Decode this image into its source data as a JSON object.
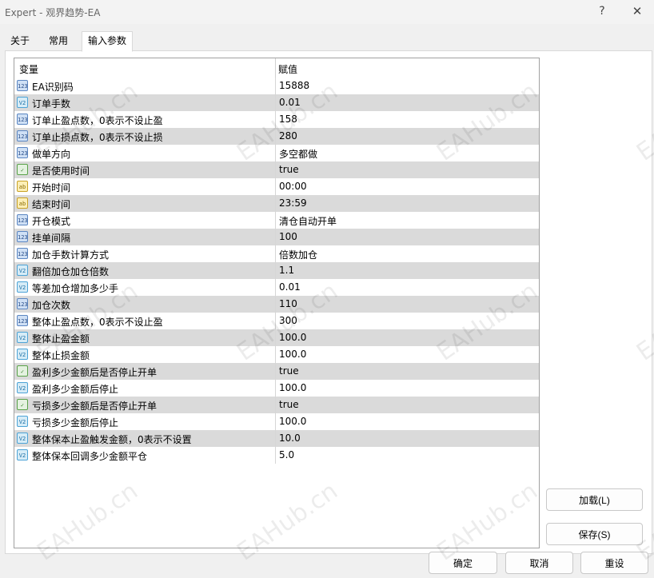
{
  "window": {
    "title": "Expert - 观界趋势-EA",
    "help_glyph": "?",
    "close_glyph": "✕"
  },
  "tabs": [
    {
      "label": "关于",
      "active": false
    },
    {
      "label": "常用",
      "active": false
    },
    {
      "label": "输入参数",
      "active": true
    }
  ],
  "grid": {
    "col_variable": "变量",
    "col_value": "赋值",
    "rows": [
      {
        "icon": "123",
        "name": "EA识别码",
        "value": "15888"
      },
      {
        "icon": "v2",
        "name": "订单手数",
        "value": "0.01"
      },
      {
        "icon": "123",
        "name": "订单止盈点数，0表示不设止盈",
        "value": "158"
      },
      {
        "icon": "123",
        "name": "订单止损点数，0表示不设止损",
        "value": "280"
      },
      {
        "icon": "123",
        "name": "做单方向",
        "value": "多空都做"
      },
      {
        "icon": "bool",
        "name": "是否使用时间",
        "value": "true"
      },
      {
        "icon": "ab",
        "name": "开始时间",
        "value": "00:00"
      },
      {
        "icon": "ab",
        "name": "结束时间",
        "value": "23:59"
      },
      {
        "icon": "123",
        "name": "开仓模式",
        "value": "清仓自动开单"
      },
      {
        "icon": "123",
        "name": "挂单间隔",
        "value": "100"
      },
      {
        "icon": "123",
        "name": "加仓手数计算方式",
        "value": "倍数加仓"
      },
      {
        "icon": "v2",
        "name": "翻倍加仓加仓倍数",
        "value": "1.1"
      },
      {
        "icon": "v2",
        "name": "等差加仓增加多少手",
        "value": "0.01"
      },
      {
        "icon": "123",
        "name": "加仓次数",
        "value": "110"
      },
      {
        "icon": "123",
        "name": "整体止盈点数，0表示不设止盈",
        "value": "300"
      },
      {
        "icon": "v2",
        "name": "整体止盈金额",
        "value": "100.0"
      },
      {
        "icon": "v2",
        "name": "整体止损金额",
        "value": "100.0"
      },
      {
        "icon": "bool",
        "name": "盈利多少金额后是否停止开单",
        "value": "true"
      },
      {
        "icon": "v2",
        "name": "盈利多少金额后停止",
        "value": "100.0"
      },
      {
        "icon": "bool",
        "name": "亏损多少金额后是否停止开单",
        "value": "true"
      },
      {
        "icon": "v2",
        "name": "亏损多少金额后停止",
        "value": "100.0"
      },
      {
        "icon": "v2",
        "name": "整体保本止盈触发金额，0表示不设置",
        "value": "10.0"
      },
      {
        "icon": "v2",
        "name": "整体保本回调多少金额平仓",
        "value": "5.0"
      }
    ]
  },
  "icon_glyphs": {
    "123": "123",
    "v2": "V2",
    "bool": "✓",
    "ab": "ab"
  },
  "buttons": {
    "load": "加载(L)",
    "save": "保存(S)",
    "ok": "确定",
    "cancel": "取消",
    "reset": "重设"
  },
  "watermark": "EAHub.cn"
}
